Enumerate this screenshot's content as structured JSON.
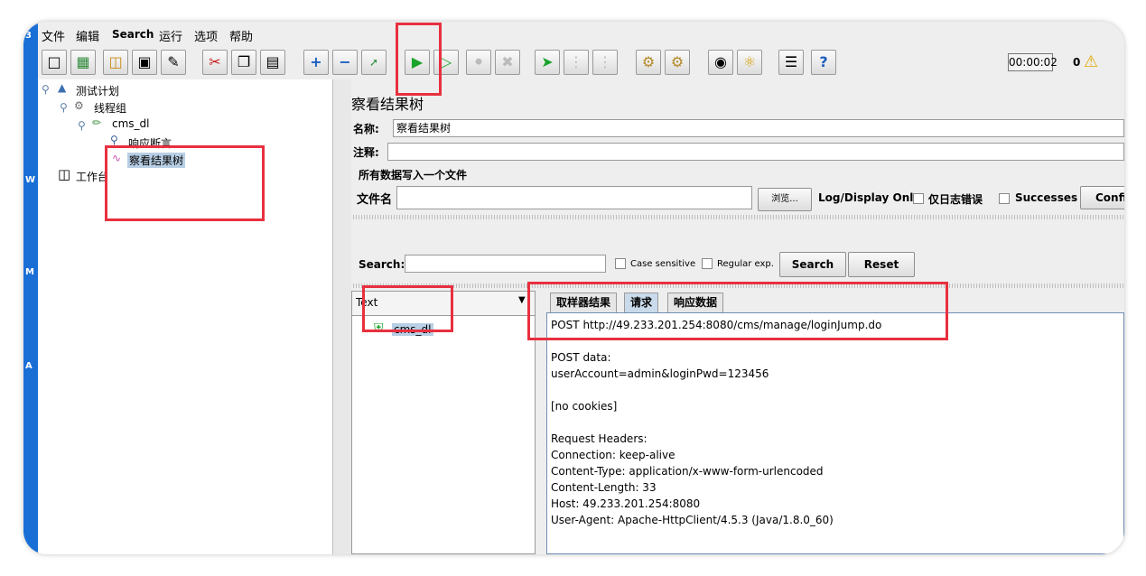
{
  "menu": [
    "文件",
    "编辑",
    "Search",
    "运行",
    "选项",
    "帮助"
  ],
  "toolbar": {
    "timer": "00:00:02",
    "warning_count": "0"
  },
  "tree": {
    "test_plan": "测试计划",
    "thread_group": "线程组",
    "sampler": "cms_dl",
    "assertion": "响应断言",
    "listener": "察看结果树",
    "workbench": "工作台"
  },
  "panel": {
    "title": "察看结果树",
    "name_label": "名称:",
    "name_value": "察看结果树",
    "comment_label": "注释:",
    "comment_value": "",
    "file_section": "所有数据写入一个文件",
    "filename_label": "文件名",
    "filename_value": "",
    "browse_label": "浏览...",
    "log_display_label": "Log/Display Only:",
    "errors_label": "仅日志错误",
    "successes_label": "Successes",
    "configure_label": "Confi"
  },
  "search": {
    "label": "Search:",
    "value": "",
    "case_label": "Case sensitive",
    "regex_label": "Regular exp.",
    "search_button": "Search",
    "reset_button": "Reset"
  },
  "results": {
    "renderer": "Text",
    "items": [
      "cms_dl"
    ],
    "tabs": [
      "取样器结果",
      "请求",
      "响应数据"
    ],
    "active_tab": "请求",
    "request_lines": [
      "POST http://49.233.201.254:8080/cms/manage/loginJump.do",
      "",
      "POST data:",
      "userAccount=admin&loginPwd=123456",
      "",
      "[no cookies]",
      "",
      "Request Headers:",
      "Connection: keep-alive",
      "Content-Type: application/x-www-form-urlencoded",
      "Content-Length: 33",
      "Host: 49.233.201.254:8080",
      "User-Agent: Apache-HttpClient/4.5.3 (Java/1.8.0_60)"
    ]
  },
  "desktop_glyphs": [
    "3",
    "W",
    "M",
    "A"
  ],
  "colors": {
    "highlight": "#e8303f",
    "selection": "#b8cfe5",
    "run_green": "#1aa32a"
  }
}
